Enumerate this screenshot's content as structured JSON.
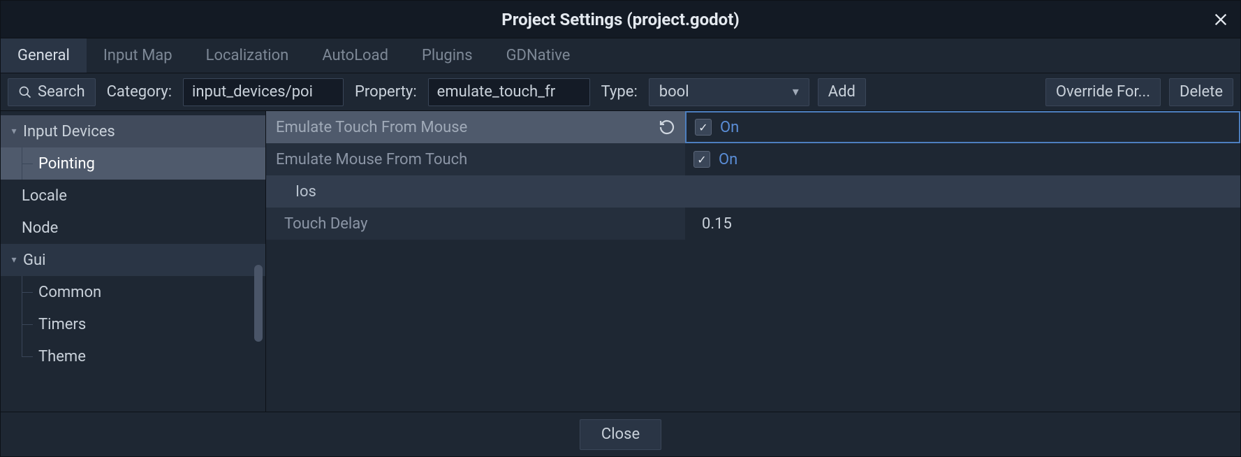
{
  "window": {
    "title": "Project Settings (project.godot)"
  },
  "tabs": {
    "items": [
      {
        "label": "General",
        "active": true
      },
      {
        "label": "Input Map",
        "active": false
      },
      {
        "label": "Localization",
        "active": false
      },
      {
        "label": "AutoLoad",
        "active": false
      },
      {
        "label": "Plugins",
        "active": false
      },
      {
        "label": "GDNative",
        "active": false
      }
    ]
  },
  "filter": {
    "search_label": "Search",
    "category_label": "Category:",
    "category_value": "input_devices/poi",
    "property_label": "Property:",
    "property_value": "emulate_touch_fr",
    "type_label": "Type:",
    "type_value": "bool",
    "add_label": "Add",
    "override_label": "Override For...",
    "delete_label": "Delete"
  },
  "tree": {
    "items": [
      {
        "label": "Input Devices",
        "level": 0,
        "expandable": true,
        "selectedParent": true
      },
      {
        "label": "Pointing",
        "level": 1,
        "selected": true
      },
      {
        "label": "Locale",
        "level": 0
      },
      {
        "label": "Node",
        "level": 0
      },
      {
        "label": "Gui",
        "level": 0,
        "expandable": true,
        "gui": true
      },
      {
        "label": "Common",
        "level": 1
      },
      {
        "label": "Timers",
        "level": 1
      },
      {
        "label": "Theme",
        "level": 1,
        "last": true
      }
    ]
  },
  "props": {
    "rows": [
      {
        "name": "Emulate Touch From Mouse",
        "type": "bool",
        "value": "On",
        "highlighted": true,
        "reset": true
      },
      {
        "name": "Emulate Mouse From Touch",
        "type": "bool",
        "value": "On"
      },
      {
        "name": "Ios",
        "type": "subheader"
      },
      {
        "name": "Touch Delay",
        "type": "number",
        "value": "0.15"
      }
    ]
  },
  "footer": {
    "close_label": "Close"
  }
}
